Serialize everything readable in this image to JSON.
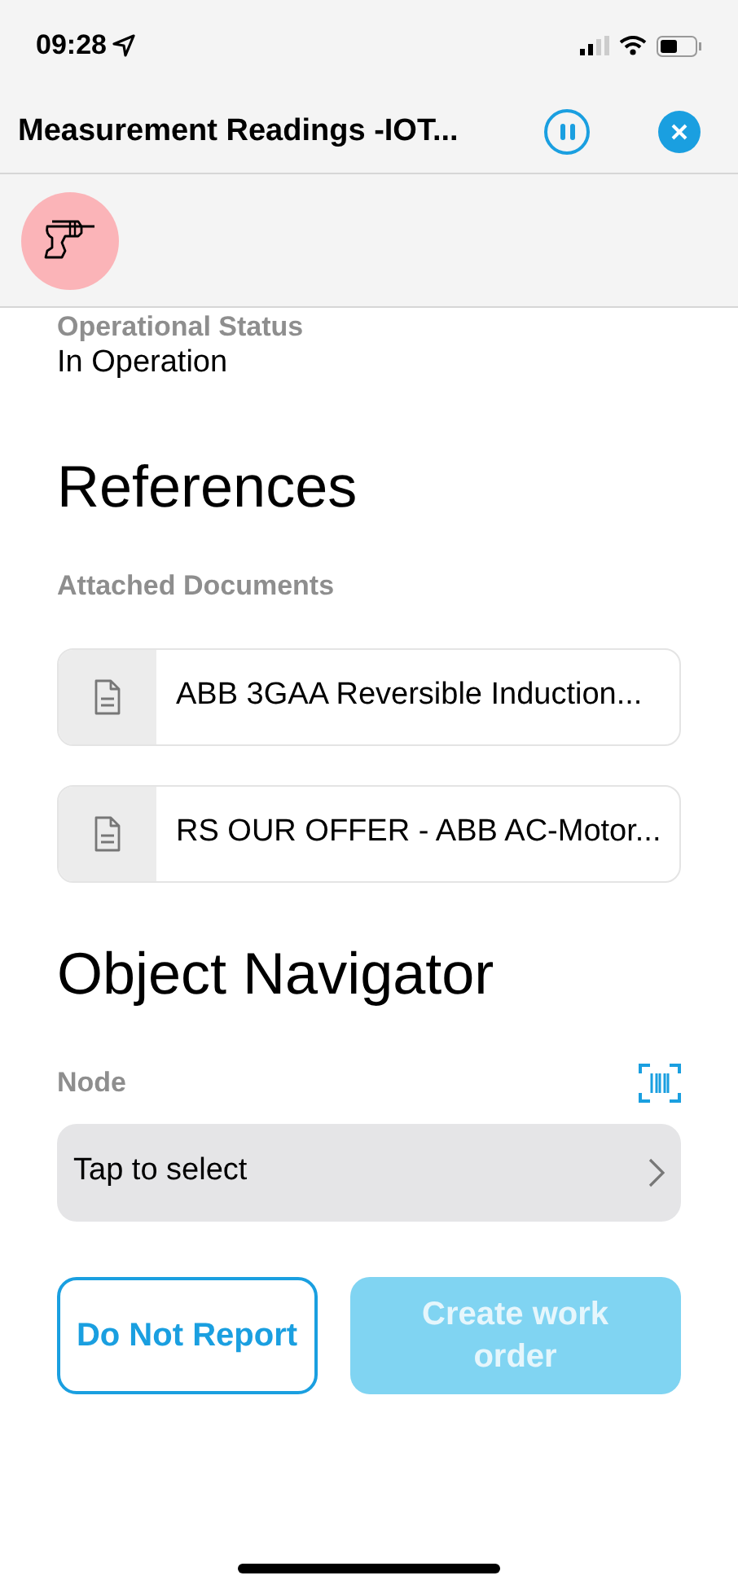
{
  "status_bar": {
    "time": "09:28"
  },
  "header": {
    "title": "Measurement Readings -IOT..."
  },
  "status_field": {
    "label": "Operational Status",
    "value": "In Operation"
  },
  "references": {
    "heading": "References",
    "subheading": "Attached Documents",
    "documents": [
      {
        "name": "ABB 3GAA Reversible Induction..."
      },
      {
        "name": "RS OUR OFFER - ABB AC-Motor..."
      }
    ]
  },
  "navigator": {
    "heading": "Object Navigator",
    "node_label": "Node",
    "node_placeholder": "Tap to select"
  },
  "buttons": [
    {
      "label": "Do Not Report",
      "kind": "outline",
      "disabled": false
    },
    {
      "label": "Create work order",
      "kind": "filled",
      "disabled": true
    }
  ]
}
